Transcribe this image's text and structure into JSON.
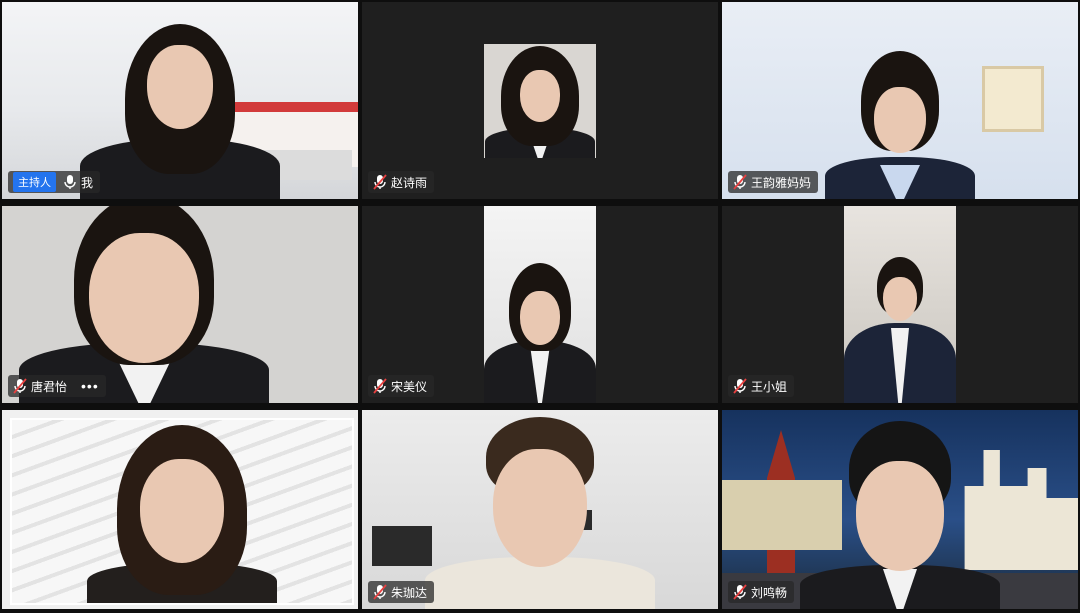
{
  "participants": [
    {
      "name": "我",
      "host_badge": "主持人",
      "mic": "on"
    },
    {
      "name": "赵诗雨",
      "mic": "muted"
    },
    {
      "name": "王韵雅妈妈",
      "mic": "muted"
    },
    {
      "name": "唐君怡",
      "mic": "muted",
      "more": "•••"
    },
    {
      "name": "宋美仪",
      "mic": "muted"
    },
    {
      "name": "王小姐",
      "mic": "muted"
    },
    {
      "name": "",
      "mic": "none"
    },
    {
      "name": "朱珈达",
      "mic": "muted"
    },
    {
      "name": "刘鸣畅",
      "mic": "muted"
    }
  ],
  "colors": {
    "host_badge": "#2474ee",
    "muted_icon": "#e84040",
    "background": "#0e0e0e"
  },
  "icons": {
    "mic_on": "microphone-icon",
    "mic_muted": "microphone-muted-icon",
    "more": "more-dots-icon"
  }
}
